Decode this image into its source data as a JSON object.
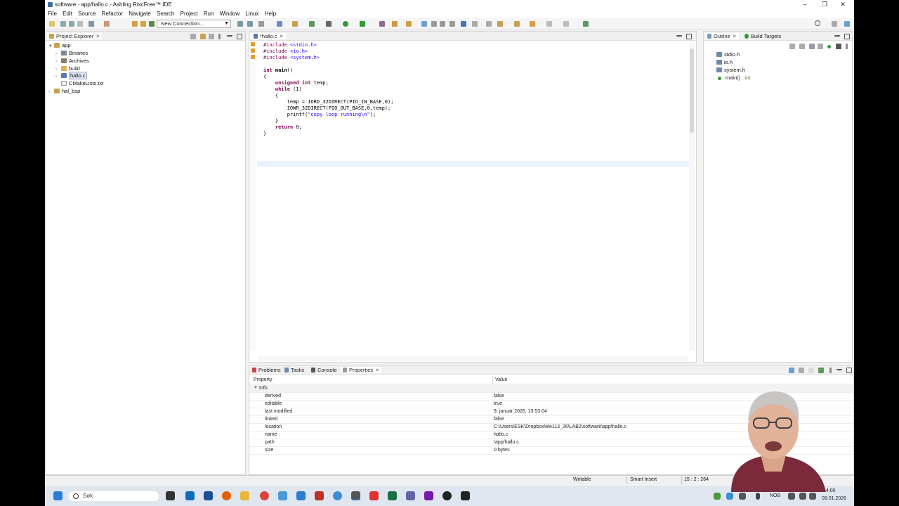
{
  "window": {
    "title": "software - app/hallo.c - Ashling RiscFree™ IDE"
  },
  "menu": [
    "File",
    "Edit",
    "Source",
    "Refactor",
    "Navigate",
    "Search",
    "Project",
    "Run",
    "Window",
    "Linux",
    "Help"
  ],
  "toolbar": {
    "connection_value": "New Connection..."
  },
  "project_explorer": {
    "tab_label": "Project Explorer",
    "items": [
      {
        "label": "app",
        "icon": "project-icon",
        "expanded": true
      },
      {
        "label": "Binaries",
        "icon": "binaries-icon"
      },
      {
        "label": "Archives",
        "icon": "archives-icon"
      },
      {
        "label": "build",
        "icon": "folder-icon"
      },
      {
        "label": "hallo.c",
        "icon": "c-file-icon",
        "selected": true
      },
      {
        "label": "CMakeLists.txt",
        "icon": "text-file-icon"
      },
      {
        "label": "hal_bsp",
        "icon": "project-icon"
      }
    ]
  },
  "editor": {
    "tab_label": "*hallo.c",
    "lines": [
      "#include <stdio.h>",
      "#include <io.h>",
      "#include <system.h>",
      "",
      "int main()",
      "{",
      "    unsigned int temp;",
      "    while (1)",
      "    {",
      "        temp = IORD_32DIRECT(PIO_IN_BASE,0);",
      "        IOWR_32DIRECT(PIO_OUT_BASE,0,temp);",
      "        printf(\"copy loop running\\n\");",
      "    }",
      "    return 0;",
      "}"
    ]
  },
  "outline": {
    "tab_label": "Outline",
    "tab2_label": "Build Targets",
    "items": [
      {
        "label": "stdio.h",
        "suffix": ""
      },
      {
        "label": "io.h",
        "suffix": ""
      },
      {
        "label": "system.h",
        "suffix": ""
      },
      {
        "label": "main()",
        "suffix": " : int"
      }
    ]
  },
  "bottom": {
    "tabs": [
      "Problems",
      "Tasks",
      "Console",
      "Properties"
    ],
    "col_property": "Property",
    "col_value": "Value",
    "group": "Info",
    "rows": [
      {
        "k": "derived",
        "v": "false"
      },
      {
        "k": "editable",
        "v": "true"
      },
      {
        "k": "last modified",
        "v": "9. januar 2026, 13:53:04"
      },
      {
        "k": "linked",
        "v": "false"
      },
      {
        "k": "location",
        "v": "C:\\Users\\ESK\\Dropbox\\ele113_26\\LAB2\\software\\app\\hallo.c"
      },
      {
        "k": "name",
        "v": "hallo.c"
      },
      {
        "k": "path",
        "v": "/app/hallo.c"
      },
      {
        "k": "size",
        "v": "0  bytes"
      }
    ]
  },
  "status": {
    "writable": "Writable",
    "insert": "Smart Insert",
    "position": "15 : 2 : 264"
  },
  "taskbar": {
    "search_placeholder": "Søk",
    "lang": "NOB",
    "date": "09.01.2026",
    "time": "14:00"
  },
  "colors": {
    "accent": "#3a6ea5",
    "keyword": "#7f0055",
    "string": "#2a00ff"
  }
}
